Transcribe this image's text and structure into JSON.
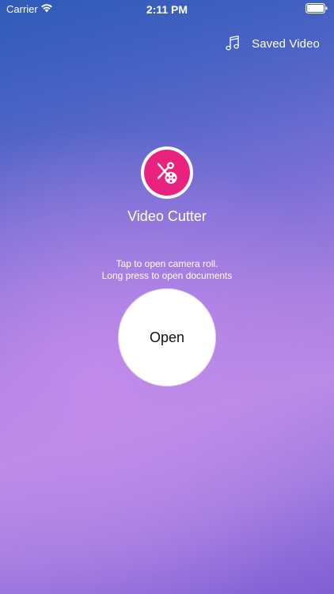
{
  "status_bar": {
    "carrier": "Carrier",
    "time": "2:11 PM",
    "wifi_icon": "wifi-icon",
    "battery_icon": "battery-icon"
  },
  "header": {
    "saved_label": "Saved Video",
    "saved_icon": "music-note-icon"
  },
  "app": {
    "title": "Video Cutter",
    "icon": "scissors-film-icon",
    "accent_color": "#e8227e"
  },
  "hint": {
    "line1": "Tap to open camera roll.",
    "line2": "Long press to open documents"
  },
  "open_button": {
    "label": "Open"
  }
}
